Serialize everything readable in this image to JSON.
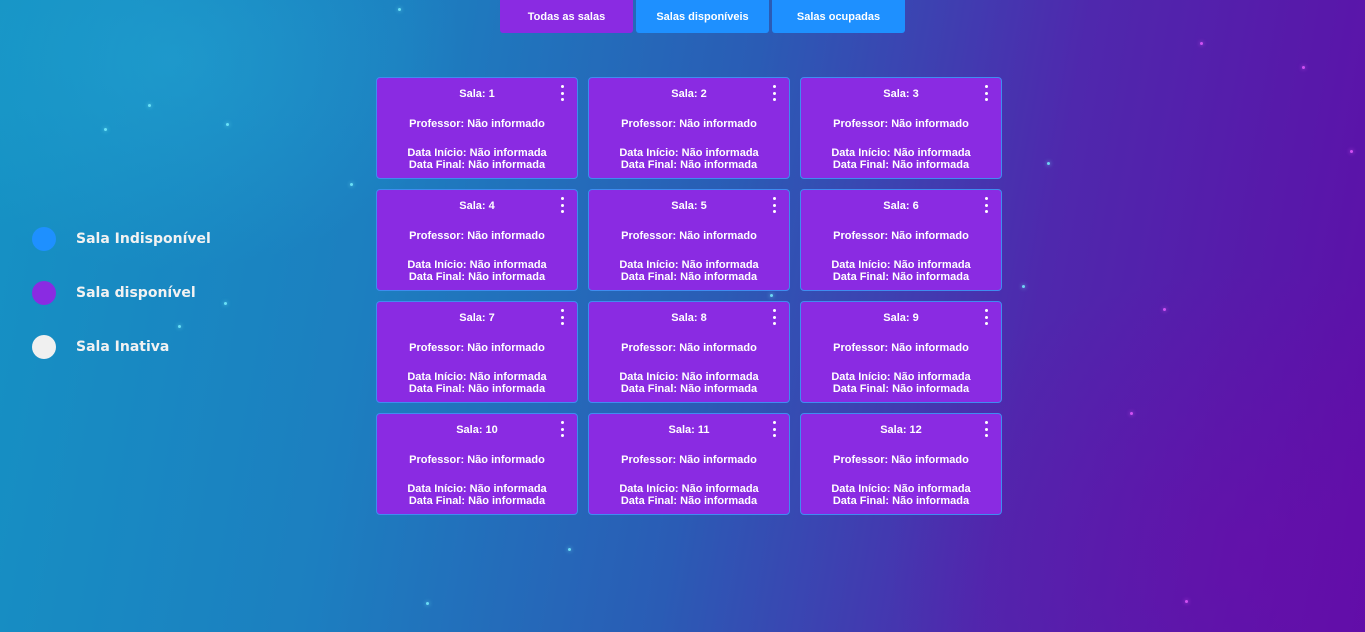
{
  "filters": [
    {
      "label": "Todas as salas",
      "active": true
    },
    {
      "label": "Salas disponíveis",
      "active": false
    },
    {
      "label": "Salas ocupadas",
      "active": false
    }
  ],
  "legend": [
    {
      "label": "Sala Indisponível",
      "color": "#1e90ff"
    },
    {
      "label": "Sala disponível",
      "color": "#8a2be2"
    },
    {
      "label": "Sala Inativa",
      "color": "#f0f0f0"
    }
  ],
  "colors": {
    "card": "#8a2be2",
    "card_border": "#3f8cf0",
    "button_active": "#8a2be2",
    "button_inactive": "#1e90ff"
  },
  "menu_icon": "kebab-vertical-icon",
  "rooms": [
    {
      "title": "Sala: 1",
      "professor": "Professor: Não informado",
      "start": "Data Início: Não informada",
      "end": "Data Final: Não informada"
    },
    {
      "title": "Sala: 2",
      "professor": "Professor: Não informado",
      "start": "Data Início: Não informada",
      "end": "Data Final: Não informada"
    },
    {
      "title": "Sala: 3",
      "professor": "Professor: Não informado",
      "start": "Data Início: Não informada",
      "end": "Data Final: Não informada"
    },
    {
      "title": "Sala: 4",
      "professor": "Professor: Não informado",
      "start": "Data Início: Não informada",
      "end": "Data Final: Não informada"
    },
    {
      "title": "Sala: 5",
      "professor": "Professor: Não informado",
      "start": "Data Início: Não informada",
      "end": "Data Final: Não informada"
    },
    {
      "title": "Sala: 6",
      "professor": "Professor: Não informado",
      "start": "Data Início: Não informada",
      "end": "Data Final: Não informada"
    },
    {
      "title": "Sala: 7",
      "professor": "Professor: Não informado",
      "start": "Data Início: Não informada",
      "end": "Data Final: Não informada"
    },
    {
      "title": "Sala: 8",
      "professor": "Professor: Não informado",
      "start": "Data Início: Não informada",
      "end": "Data Final: Não informada"
    },
    {
      "title": "Sala: 9",
      "professor": "Professor: Não informado",
      "start": "Data Início: Não informada",
      "end": "Data Final: Não informada"
    },
    {
      "title": "Sala: 10",
      "professor": "Professor: Não informado",
      "start": "Data Início: Não informada",
      "end": "Data Final: Não informada"
    },
    {
      "title": "Sala: 11",
      "professor": "Professor: Não informado",
      "start": "Data Início: Não informada",
      "end": "Data Final: Não informada"
    },
    {
      "title": "Sala: 12",
      "professor": "Professor: Não informado",
      "start": "Data Início: Não informada",
      "end": "Data Final: Não informada"
    }
  ]
}
